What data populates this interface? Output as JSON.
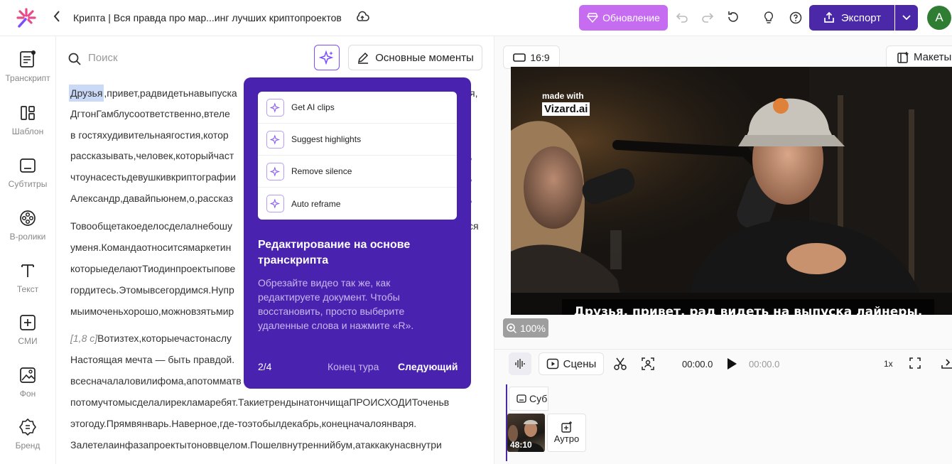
{
  "header": {
    "title": "Крипта | Вся правда про мар...инг лучших криптопроектов",
    "upgrade_label": "Обновление",
    "export_label": "Экспорт",
    "avatar_letter": "A",
    "colors": {
      "upgrade": "#c56cf0",
      "export": "#4a28a8",
      "avatar": "#2e7d32"
    }
  },
  "sidebar": {
    "items": [
      {
        "label": "Транскрипт",
        "icon": "transcript-icon"
      },
      {
        "label": "Шаблон",
        "icon": "template-icon"
      },
      {
        "label": "Субтитры",
        "icon": "subtitles-icon"
      },
      {
        "label": "В-ролики",
        "icon": "broll-icon"
      },
      {
        "label": "Текст",
        "icon": "text-icon"
      },
      {
        "label": "СМИ",
        "icon": "media-icon"
      },
      {
        "label": "Фон",
        "icon": "background-icon"
      },
      {
        "label": "Бренд",
        "icon": "brand-icon"
      }
    ]
  },
  "transcript": {
    "search_placeholder": "Поиск",
    "moments_label": "Основные моменты",
    "highlight_word": "Друзья",
    "lines": [
      ",привет,радвидетьнавыпуска",
      "ДгтонГамблусоответственно,втеле",
      "в гостяхудивительнаягостия,котор",
      "рассказывать,человек,которыйчаст",
      "чтоунасестьдевушкивкриптографии",
      "Александр,давайпьюнем,о,рассказ",
      "Товообщетакоеделосделалнебошу",
      "уменя.Командаотноситсямаркетин",
      "которыеделаютТиодинпроектыпове",
      "гордитесь.Этомывсегордимся.Нупр",
      "мыимоченьхорошо,можновзятьмир",
      "[1,8 с]",
      "Вотизтех,которыечастонаслу",
      "Настоящая мечта — быть правдой.",
      "всесначалаловилифома,апотомматв",
      "потомучтомысделалирекламаребят.ТакиетрендынатончищаПРОИСХОДИТоченьв",
      "этогоду.Прямвянварь.Наверное,где-тоэтобылдекабрь,конецначалоянваря.",
      "Залетелаинфазапроектытоноввцелом.Пошелвнутреннийбум,атаккакунасвнутри"
    ],
    "right_fragments": [
      "я,",
      "ся",
      ",",
      ",",
      ","
    ]
  },
  "tour": {
    "options": [
      {
        "label": "Get AI clips",
        "icon": "sparkle-icon"
      },
      {
        "label": "Suggest highlights",
        "icon": "sparkle-icon"
      },
      {
        "label": "Remove silence",
        "icon": "sparkle-icon"
      },
      {
        "label": "Auto reframe",
        "icon": "sparkle-icon"
      }
    ],
    "title": "Редактирование на основе транскрипта",
    "description": "Обрезайте видео так же, как редактируете документ. Чтобы восстановить, просто выберите удаленные слова и нажмите «R».",
    "step": "2/4",
    "end_label": "Конец тура",
    "next_label": "Следующий"
  },
  "preview": {
    "aspect_label": "16:9",
    "layouts_label": "Макеты",
    "watermark_top": "made with",
    "watermark_brand": "Vizard.ai",
    "subtitle": "Друзья, привет, рад видеть на выпуска лайнеры.",
    "zoom": "100%"
  },
  "controls": {
    "scenes_label": "Сцены",
    "current_time": "00:00.0",
    "total_time": "00:00.0",
    "speed": "1x"
  },
  "timeline": {
    "subtitle_chip": "Суб",
    "clip_duration": "48:10",
    "outro_label": "Аутро"
  }
}
